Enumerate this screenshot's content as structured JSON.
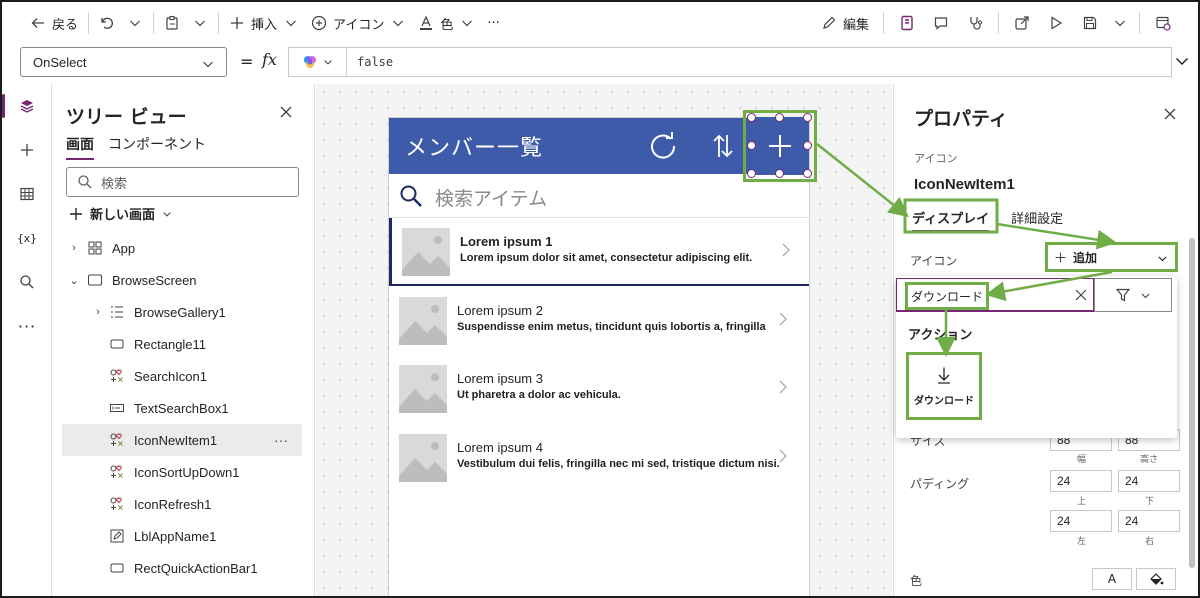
{
  "toolbar": {
    "back_label": "戻る",
    "insert_label": "挿入",
    "icon_label": "アイコン",
    "color_label": "色",
    "more_label": "···",
    "edit_label": "編集"
  },
  "formula_bar": {
    "property": "OnSelect",
    "equals": "=",
    "fx": "fx",
    "formula": "false"
  },
  "tree_view": {
    "title": "ツリー ビュー",
    "tabs": [
      "画面",
      "コンポーネント"
    ],
    "search_placeholder": "検索",
    "new_screen_label": "新しい画面",
    "nodes": [
      {
        "label": "App",
        "icon": "app-icon",
        "level": 0,
        "expander": "›"
      },
      {
        "label": "BrowseScreen",
        "icon": "screen-icon",
        "level": 0,
        "expander": "⌄"
      },
      {
        "label": "BrowseGallery1",
        "icon": "gallery-icon",
        "level": 1,
        "expander": "›"
      },
      {
        "label": "Rectangle11",
        "icon": "rectangle-icon",
        "level": 1,
        "expander": ""
      },
      {
        "label": "SearchIcon1",
        "icon": "icon-control-icon",
        "level": 1,
        "expander": ""
      },
      {
        "label": "TextSearchBox1",
        "icon": "textbox-icon",
        "level": 1,
        "expander": ""
      },
      {
        "label": "IconNewItem1",
        "icon": "icon-control-icon",
        "level": 1,
        "expander": "",
        "selected": true
      },
      {
        "label": "IconSortUpDown1",
        "icon": "icon-control-icon",
        "level": 1,
        "expander": ""
      },
      {
        "label": "IconRefresh1",
        "icon": "icon-control-icon",
        "level": 1,
        "expander": ""
      },
      {
        "label": "LblAppName1",
        "icon": "label-icon",
        "level": 1,
        "expander": ""
      },
      {
        "label": "RectQuickActionBar1",
        "icon": "rectangle-icon",
        "level": 1,
        "expander": ""
      }
    ],
    "more_label": "···"
  },
  "app_preview": {
    "title": "メンバー一覧",
    "search_placeholder": "検索アイテム",
    "items": [
      {
        "title": "Lorem ipsum 1",
        "subtitle": "Lorem ipsum dolor sit amet, consectetur adipiscing elit."
      },
      {
        "title": "Lorem ipsum 2",
        "subtitle": "Suspendisse enim metus, tincidunt quis lobortis a, fringilla"
      },
      {
        "title": "Lorem ipsum 3",
        "subtitle": "Ut pharetra a dolor ac vehicula."
      },
      {
        "title": "Lorem ipsum 4",
        "subtitle": "Vestibulum dui felis, fringilla nec mi sed, tristique dictum nisi."
      }
    ]
  },
  "properties": {
    "title": "プロパティ",
    "control_type": "アイコン",
    "control_name": "IconNewItem1",
    "tabs": [
      "ディスプレイ",
      "詳細設定"
    ],
    "icon_label": "アイコン",
    "icon_value": "追加",
    "size_label": "サイズ",
    "size_width": "88",
    "size_height": "88",
    "width_caption": "幅",
    "height_caption": "高さ",
    "padding_label": "パディング",
    "padding_top": "24",
    "padding_bottom": "24",
    "padding_left": "24",
    "padding_right": "24",
    "top_caption": "上",
    "bottom_caption": "下",
    "left_caption": "左",
    "right_caption": "右",
    "color_label": "色",
    "font_color_label": "A"
  },
  "icon_picker": {
    "search_value": "ダウンロード",
    "category": "アクション",
    "result_label": "ダウンロード"
  },
  "colors": {
    "accent": "#742774",
    "app_header": "#3d5ba8",
    "highlight": "#70ad47"
  }
}
